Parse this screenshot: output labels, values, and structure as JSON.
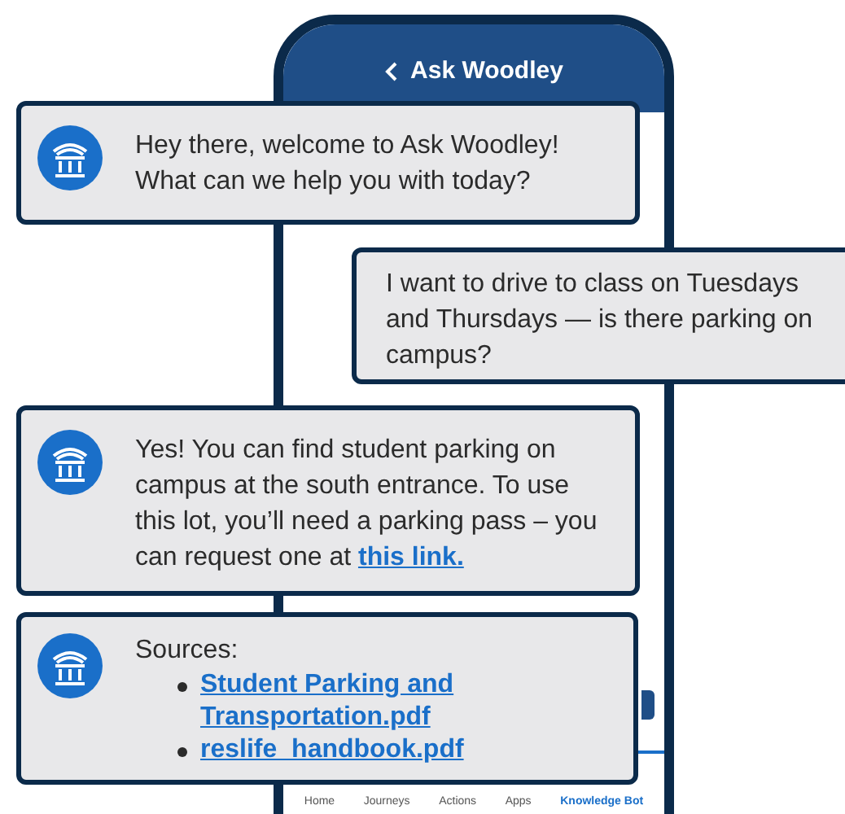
{
  "header": {
    "title": "Ask Woodley"
  },
  "messages": [
    {
      "kind": "bot",
      "text": "Hey there, welcome to Ask Woodley! What can we help you with today?"
    },
    {
      "kind": "user",
      "text": "I want to drive to class on Tuesdays and Thursdays — is there parking on campus?"
    },
    {
      "kind": "bot",
      "text": "Yes! You can find student parking on campus at the south entrance. To use this lot, you’ll need a parking pass – you can request one at ",
      "link": "this link."
    },
    {
      "kind": "sources",
      "label": "Sources:",
      "links": [
        "Student Parking and Transportation.pdf",
        "reslife_handbook.pdf"
      ]
    }
  ],
  "nav": [
    {
      "label": "Home",
      "selected": false
    },
    {
      "label": "Journeys",
      "selected": false
    },
    {
      "label": "Actions",
      "selected": false
    },
    {
      "label": "Apps",
      "selected": false
    },
    {
      "label": "Knowledge Bot",
      "selected": true
    }
  ]
}
